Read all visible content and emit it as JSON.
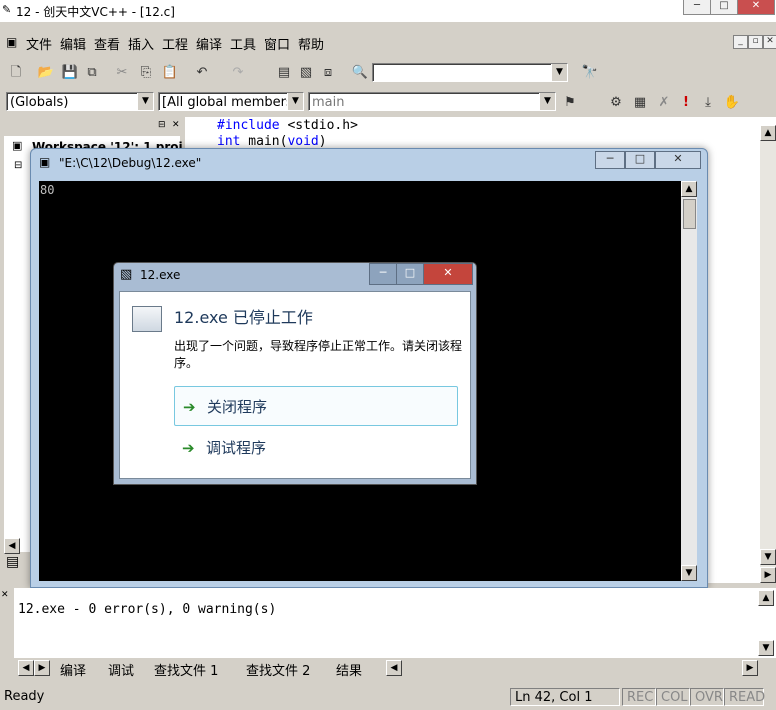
{
  "app": {
    "title": "12 - 创天中文VC++ - [12.c]"
  },
  "menu": [
    "文件",
    "编辑",
    "查看",
    "插入",
    "工程",
    "编译",
    "工具",
    "窗口",
    "帮助"
  ],
  "toolbar": {
    "find_combo_value": ""
  },
  "wizardbar": {
    "class_combo": "(Globals)",
    "filter_combo": "[All global members",
    "member_combo": "main"
  },
  "workspace": {
    "title": "Workspace '12': 1 proj"
  },
  "editor": {
    "lines": [
      "#include <stdio.h>",
      "int main(void)"
    ],
    "keyword_include": "#include",
    "rest_include": " <stdio.h>",
    "keyword_int": "int",
    "rest_main": " main(",
    "keyword_void": "void",
    "close_paren": ")"
  },
  "console": {
    "title": "\"E:\\C\\12\\Debug\\12.exe\"",
    "output": "80"
  },
  "dialog": {
    "title": "12.exe",
    "heading": "12.exe 已停止工作",
    "message": "出现了一个问题，导致程序停止正常工作。请关闭该程序。",
    "close_program": "关闭程序",
    "debug_program": "调试程序"
  },
  "output": {
    "text": "12.exe - 0 error(s), 0 warning(s)"
  },
  "tabs": [
    "编译",
    "调试",
    "查找文件 1",
    "查找文件 2",
    "结果"
  ],
  "status": {
    "ready": "Ready",
    "position": "Ln 42, Col 1",
    "rec": "REC",
    "col": "COL",
    "ovr": "OVR",
    "read": "READ"
  },
  "colors": {
    "accent": "#1e395b",
    "console_bg": "#000000",
    "keyword": "#0000ff"
  }
}
